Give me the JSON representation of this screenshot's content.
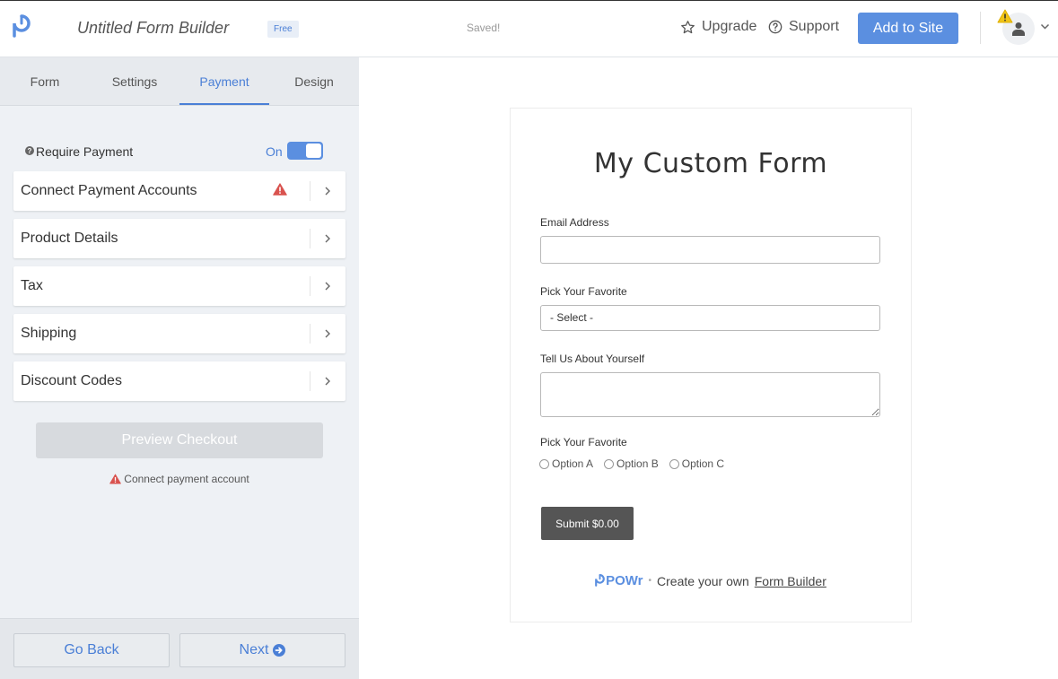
{
  "topbar": {
    "app_title": "Untitled Form Builder",
    "plan_badge": "Free",
    "save_status": "Saved!",
    "upgrade_label": "Upgrade",
    "support_label": "Support",
    "add_to_site_label": "Add to Site",
    "icons": [
      "powr-logo-icon",
      "star-icon",
      "help-circle-icon",
      "warning-icon",
      "user-icon",
      "chevron-down-icon"
    ]
  },
  "sidebar": {
    "tabs": [
      {
        "label": "Form",
        "active": false
      },
      {
        "label": "Settings",
        "active": false
      },
      {
        "label": "Payment",
        "active": true
      },
      {
        "label": "Design",
        "active": false
      }
    ],
    "require_payment": {
      "label": "Require Payment",
      "state": "On",
      "enabled": true
    },
    "panels": [
      {
        "label": "Connect Payment Accounts",
        "warning": true
      },
      {
        "label": "Product Details",
        "warning": false
      },
      {
        "label": "Tax",
        "warning": false
      },
      {
        "label": "Shipping",
        "warning": false
      },
      {
        "label": "Discount Codes",
        "warning": false
      }
    ],
    "preview_checkout_label": "Preview Checkout",
    "connect_note": "Connect payment account",
    "go_back_label": "Go Back",
    "next_label": "Next"
  },
  "form": {
    "title": "My Custom Form",
    "email_label": "Email Address",
    "email_value": "",
    "select_label": "Pick Your Favorite",
    "select_value": "- Select -",
    "textarea_label": "Tell Us About Yourself",
    "textarea_value": "",
    "radio_label": "Pick Your Favorite",
    "radio_options": [
      "Option A",
      "Option B",
      "Option C"
    ],
    "submit_label": "Submit $0.00",
    "footer_brand": "POWr",
    "footer_dot": "•",
    "footer_text": "Create your own",
    "footer_link": "Form Builder"
  },
  "colors": {
    "accent": "#5b8fe0",
    "warning_red": "#d9534f",
    "warning_yellow": "#f0c419",
    "sidebar_bg": "#eef1f5",
    "submit_bg": "#555555"
  }
}
